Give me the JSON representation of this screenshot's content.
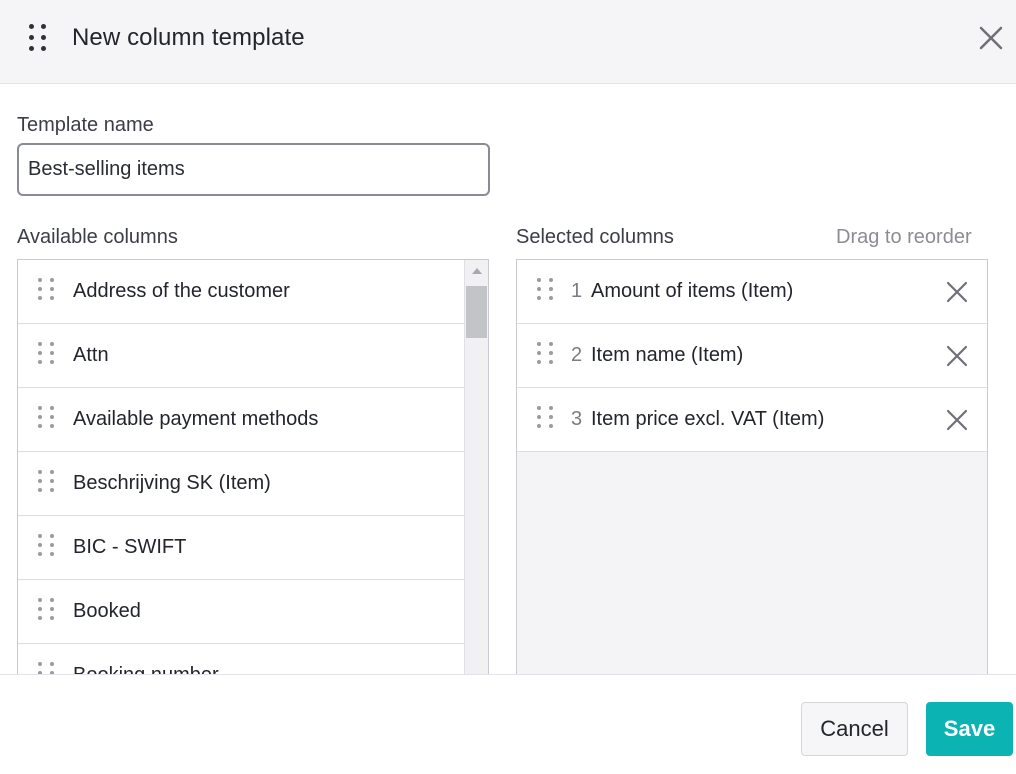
{
  "dialog": {
    "title": "New column template",
    "close_icon": "close-icon",
    "drag_icon": "drag-handle-icon"
  },
  "template_name": {
    "label": "Template name",
    "value": "Best-selling items"
  },
  "available": {
    "label": "Available columns",
    "items": [
      "Address of the customer",
      "Attn",
      "Available payment methods",
      "Beschrijving SK (Item)",
      "BIC - SWIFT",
      "Booked",
      "Booking number"
    ]
  },
  "selected": {
    "label": "Selected columns",
    "hint": "Drag to reorder",
    "items": [
      {
        "num": "1",
        "label": "Amount of items (Item)"
      },
      {
        "num": "2",
        "label": "Item name (Item)"
      },
      {
        "num": "3",
        "label": "Item price excl. VAT (Item)"
      }
    ]
  },
  "footer": {
    "cancel_label": "Cancel",
    "save_label": "Save"
  },
  "colors": {
    "accent": "#0cb3b3",
    "header_bg": "#f5f5f7",
    "border": "#c9cacf"
  }
}
